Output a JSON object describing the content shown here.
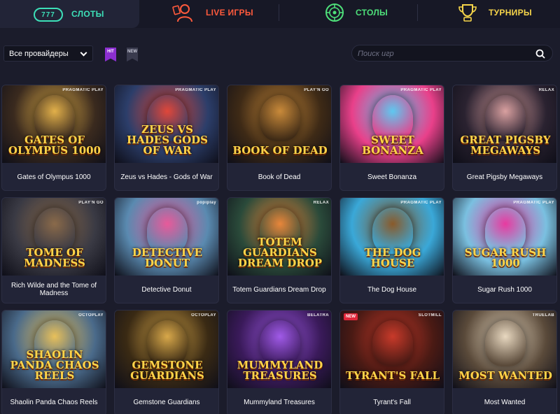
{
  "tabs": [
    {
      "label": "СЛОТЫ",
      "active": true,
      "color": "#3de0b8",
      "icon": "slot-machine-icon"
    },
    {
      "label": "LIVE ИГРЫ",
      "active": false,
      "color": "#ff5a3c",
      "icon": "dealer-icon"
    },
    {
      "label": "СТОЛЫ",
      "active": false,
      "color": "#4ee07a",
      "icon": "roulette-icon"
    },
    {
      "label": "ТУРНИРЫ",
      "active": false,
      "color": "#f6d54a",
      "icon": "trophy-icon"
    }
  ],
  "slots_icon_text": "777",
  "filters": {
    "provider_value": "Все провайдеры",
    "hit_label": "HIT",
    "new_label": "NEW",
    "search_placeholder": "Поиск игр"
  },
  "games": [
    {
      "name": "Gates of Olympus 1000",
      "logo": "Gates of Olympus 1000",
      "provider": "PRAGMATIC PLAY",
      "bg": "#3a2a1e",
      "accent": "#e2b04a"
    },
    {
      "name": "Zeus vs Hades - Gods of War",
      "logo": "Zeus vs Hades Gods of War",
      "provider": "PRAGMATIC PLAY",
      "bg": "#2c3e6a",
      "accent": "#e0473a"
    },
    {
      "name": "Book of Dead",
      "logo": "Book of Dead",
      "provider": "PLAY'N GO",
      "bg": "#3e2a16",
      "accent": "#c98a3a"
    },
    {
      "name": "Sweet Bonanza",
      "logo": "Sweet Bonanza",
      "provider": "PRAGMATIC PLAY",
      "bg": "#e9408a",
      "accent": "#5ec8f0"
    },
    {
      "name": "Great Pigsby Megaways",
      "logo": "Great Pigsby Megaways",
      "provider": "RELAX",
      "bg": "#2a2230",
      "accent": "#d9a0a0"
    },
    {
      "name": "Rich Wilde and the Tome of Madness",
      "logo": "Tome of Madness",
      "provider": "PLAY'N GO",
      "bg": "#3a3a44",
      "accent": "#8a6a4a"
    },
    {
      "name": "Detective Donut",
      "logo": "Detective Donut",
      "provider": "popiplay",
      "bg": "#5a8ab0",
      "accent": "#e85a9a"
    },
    {
      "name": "Totem Guardians Dream Drop",
      "logo": "Totem Guardians Dream Drop",
      "provider": "RELAX",
      "bg": "#2a4a3a",
      "accent": "#e8863a"
    },
    {
      "name": "The Dog House",
      "logo": "The Dog House",
      "provider": "PRAGMATIC PLAY",
      "bg": "#3aa8d8",
      "accent": "#8a5a2a"
    },
    {
      "name": "Sugar Rush 1000",
      "logo": "Sugar Rush 1000",
      "provider": "PRAGMATIC PLAY",
      "bg": "#7ac0e0",
      "accent": "#e83aa0"
    },
    {
      "name": "Shaolin Panda Chaos Reels",
      "logo": "Shaolin Panda Chaos Reels",
      "provider": "OCTOPLAY",
      "bg": "#4a6a8a",
      "accent": "#e8c05a"
    },
    {
      "name": "Gemstone Guardians",
      "logo": "Gemstone Guardians",
      "provider": "OCTOPLAY",
      "bg": "#3a2a14",
      "accent": "#d8a84a"
    },
    {
      "name": "Mummyland Treasures",
      "logo": "Mummyland Treasures",
      "provider": "BELATRA",
      "bg": "#3a1a5a",
      "accent": "#a05ae8"
    },
    {
      "name": "Tyrant's Fall",
      "logo": "Tyrant's Fall",
      "provider": "SLOTMILL",
      "badge": "NEW",
      "bg": "#4a1a14",
      "accent": "#c83a2a"
    },
    {
      "name": "Most Wanted",
      "logo": "Most Wanted",
      "provider": "TRUELAB",
      "bg": "#5a4a3a",
      "accent": "#e8d8c0"
    }
  ]
}
